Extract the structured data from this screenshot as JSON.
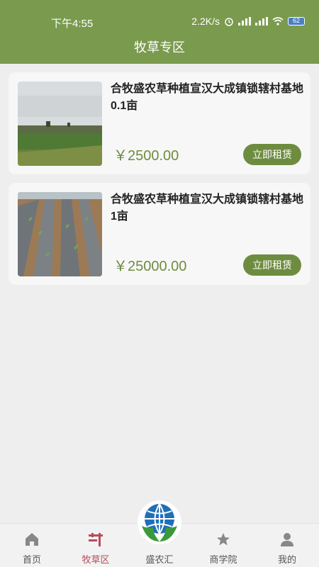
{
  "status": {
    "time": "下午4:55",
    "network_speed": "2.2K/s",
    "battery": "62"
  },
  "header": {
    "title": "牧草专区"
  },
  "listings": [
    {
      "name": "合牧盛农草种植宣汉大成镇锁辖村基地0.1亩",
      "price": "￥2500.00",
      "button": "立即租赁"
    },
    {
      "name": "合牧盛农草种植宣汉大成镇锁辖村基地1亩",
      "price": "￥25000.00",
      "button": "立即租赁"
    }
  ],
  "tabbar": {
    "items": [
      {
        "label": "首页",
        "icon": "home-icon"
      },
      {
        "label": "牧草区",
        "icon": "grass-zone-icon"
      },
      {
        "label": "盛农汇",
        "icon": "globe-leaf-logo-icon"
      },
      {
        "label": "商学院",
        "icon": "star-icon"
      },
      {
        "label": "我的",
        "icon": "profile-icon"
      }
    ],
    "active_index": 1
  },
  "colors": {
    "primary": "#7a9a4e",
    "price": "#6e8c3f",
    "button": "#6e8c3f",
    "tab_active": "#b54d5d"
  }
}
